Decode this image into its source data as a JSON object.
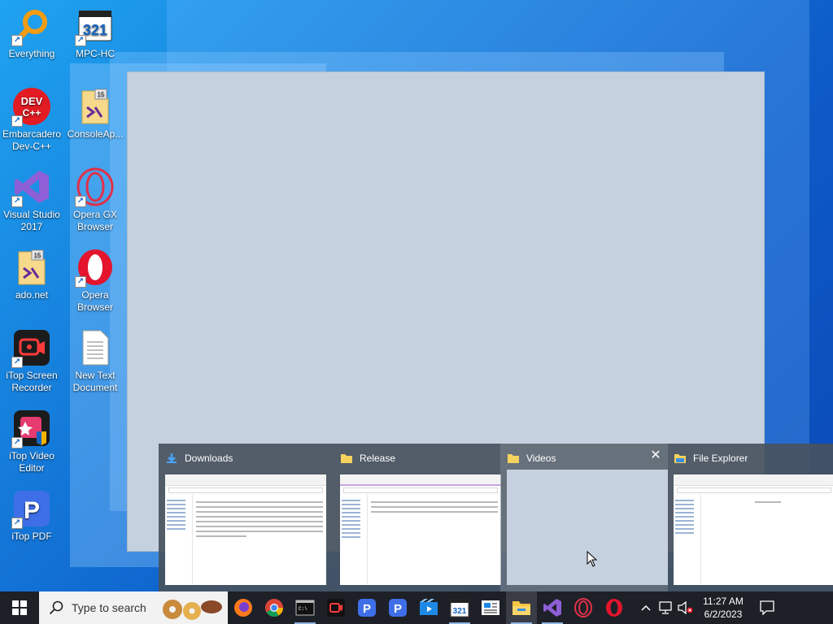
{
  "desktop": {
    "icons": [
      {
        "label": "Everything",
        "icon": "everything-icon"
      },
      {
        "label": "MPC-HC",
        "icon": "mpc-hc-icon",
        "badge": "321"
      },
      {
        "label": "Embarcadero Dev-C++",
        "icon": "devcpp-icon",
        "badge": "DEV C++"
      },
      {
        "label": "ConsoleAp...",
        "icon": "vs-project-icon",
        "badge": "15"
      },
      {
        "label": "Visual Studio 2017",
        "icon": "visual-studio-icon"
      },
      {
        "label": "Opera GX Browser",
        "icon": "opera-gx-icon"
      },
      {
        "label": "ado.net",
        "icon": "vs-project-icon",
        "badge": "15"
      },
      {
        "label": "Opera Browser",
        "icon": "opera-icon"
      },
      {
        "label": "iTop Screen Recorder",
        "icon": "itop-recorder-icon"
      },
      {
        "label": "New Text Document",
        "icon": "text-document-icon"
      },
      {
        "label": "iTop Video Editor",
        "icon": "itop-video-editor-icon"
      },
      {
        "label": "iTop PDF",
        "icon": "itop-pdf-icon",
        "badge": "P"
      }
    ]
  },
  "thumbnails": [
    {
      "title": "Downloads",
      "icon": "download-arrow-icon"
    },
    {
      "title": "Release",
      "icon": "folder-icon"
    },
    {
      "title": "Videos",
      "icon": "folder-icon",
      "close": "✕"
    },
    {
      "title": "File Explorer",
      "icon": "file-explorer-icon"
    }
  ],
  "taskbar": {
    "search_placeholder": "Type to search",
    "apps": [
      {
        "name": "firefox-icon"
      },
      {
        "name": "chrome-icon"
      },
      {
        "name": "terminal-icon",
        "label": "C:\\"
      },
      {
        "name": "itop-recorder-icon"
      },
      {
        "name": "itop-pdf-icon",
        "label": "P"
      },
      {
        "name": "itop-pdf-icon",
        "label": "P"
      },
      {
        "name": "movies-tv-icon"
      },
      {
        "name": "mpc-hc-icon",
        "label": "321"
      },
      {
        "name": "news-icon"
      },
      {
        "name": "file-explorer-icon"
      },
      {
        "name": "visual-studio-icon"
      },
      {
        "name": "opera-gx-icon"
      },
      {
        "name": "opera-icon"
      }
    ],
    "tray": {
      "chevron": "^",
      "time": "11:27 AM",
      "date": "6/2/2023"
    }
  },
  "colors": {
    "taskbar_bg": "#1e2027",
    "desktop_accent": "#1479d9",
    "thumb_strip_bg": "#48525e"
  }
}
